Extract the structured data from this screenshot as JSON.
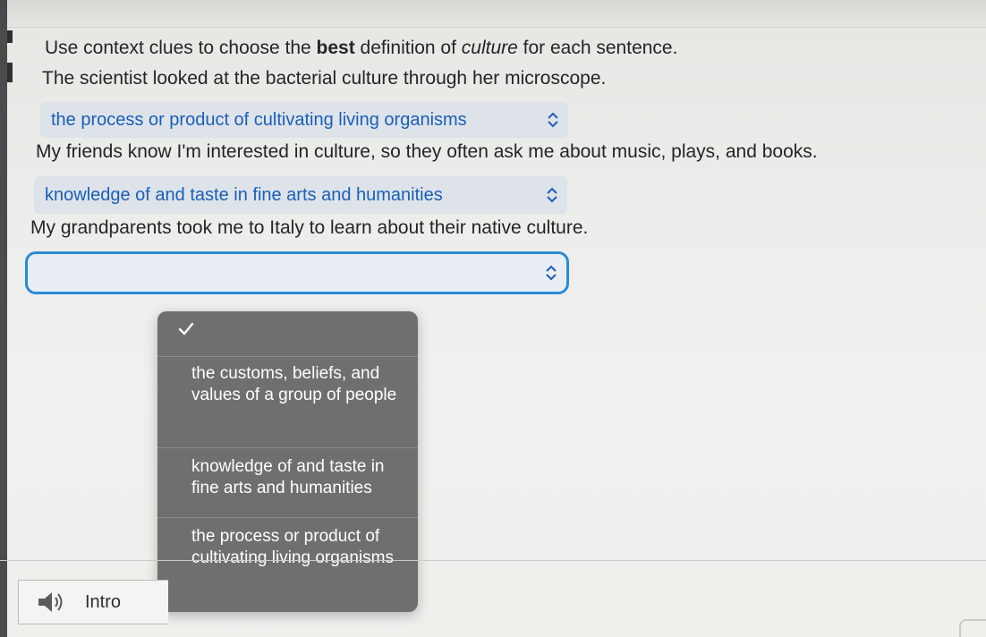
{
  "prompt": {
    "before": "Use context clues to choose the ",
    "bold": "best",
    "middle": " definition of ",
    "italic": "culture",
    "after": " for each sentence."
  },
  "sentences": [
    {
      "text": "The scientist looked at the bacterial culture through her microscope.",
      "selected": "the process or product of cultivating living organisms"
    },
    {
      "text": "My friends know I'm interested in culture, so they often ask me about music, plays, and books.",
      "selected": "knowledge of and taste in fine arts and humanities"
    },
    {
      "text": "My grandparents took me to Italy to learn about their native culture.",
      "selected": ""
    }
  ],
  "dropdown": {
    "options": [
      "the customs, beliefs, and values of a group of people",
      "knowledge of and taste in fine arts and humanities",
      "the process or product of cultivating living organisms"
    ]
  },
  "intro": {
    "label": "Intro",
    "icon": "speaker-icon"
  },
  "colors": {
    "link_blue": "#1a5fb8",
    "focus_border": "#2a8bd6",
    "menu_bg": "#6e6f71"
  }
}
